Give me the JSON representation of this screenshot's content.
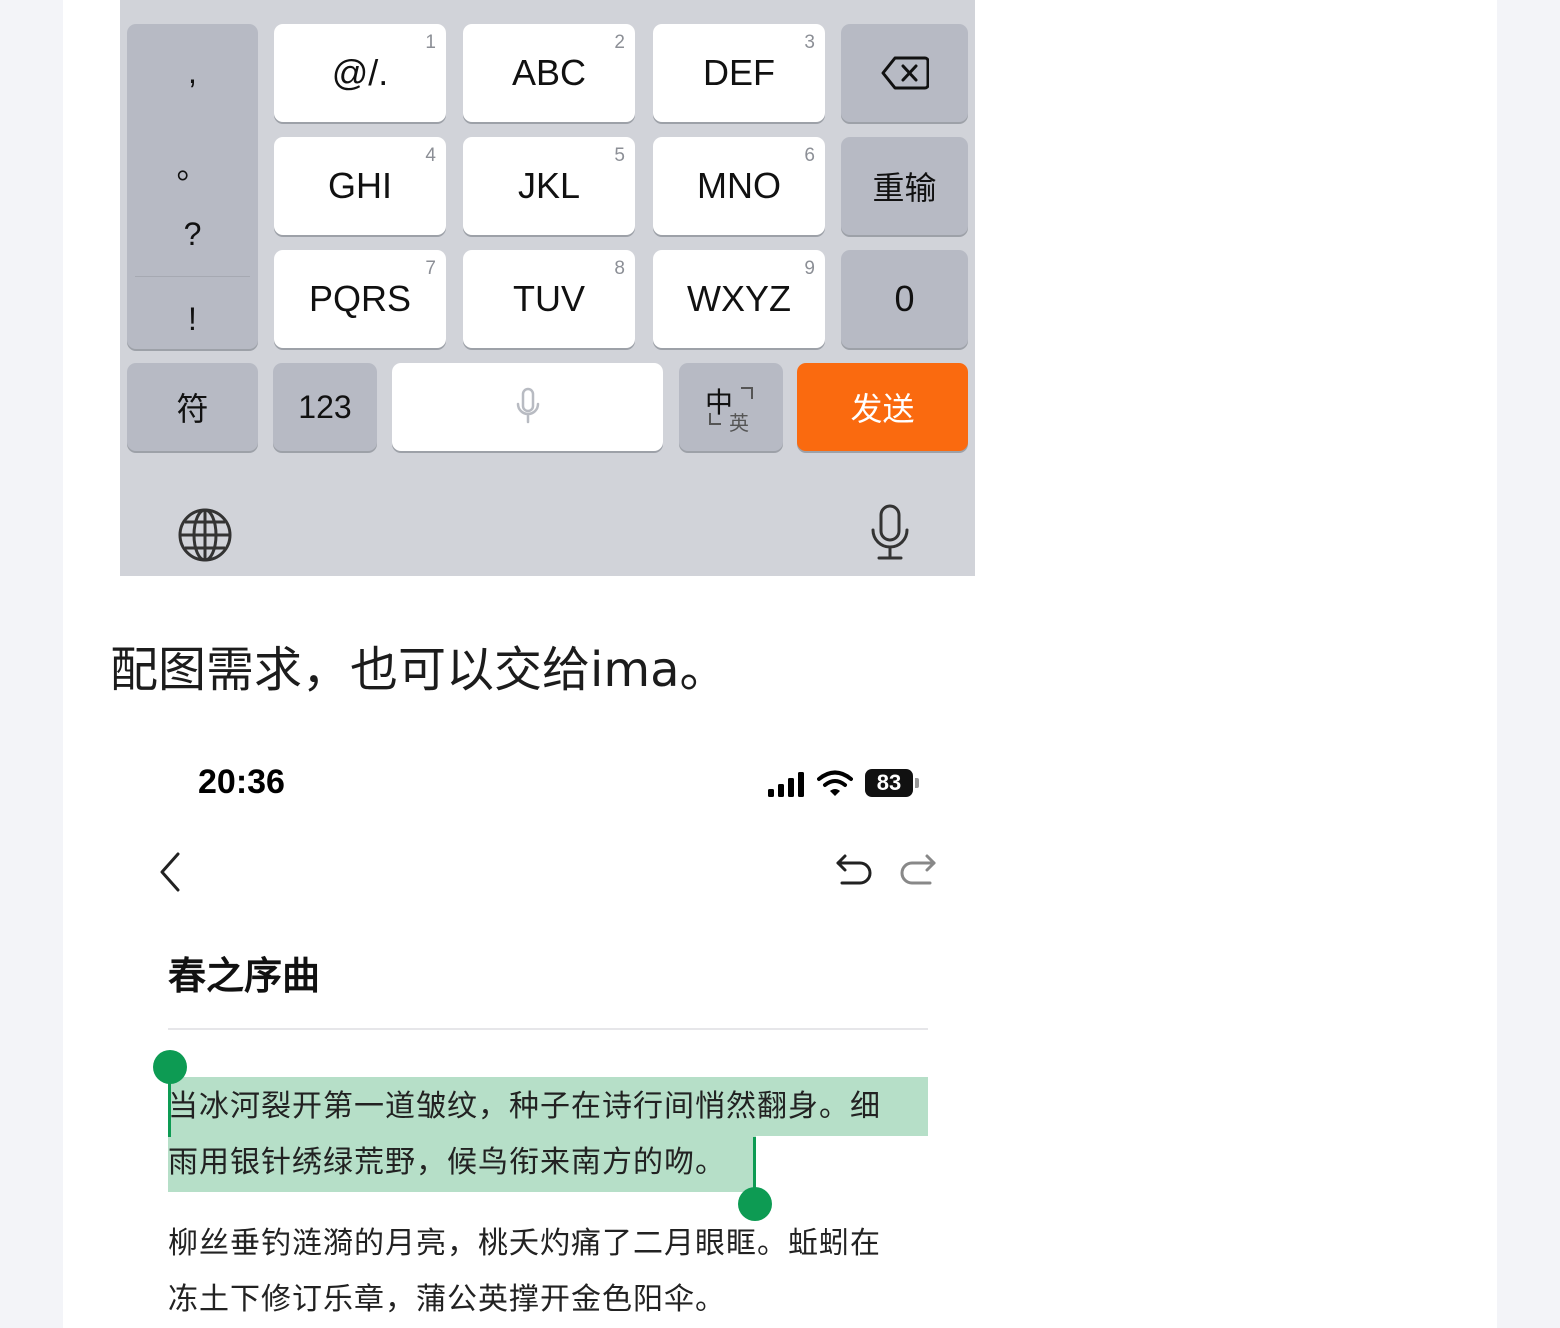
{
  "keyboard": {
    "punctuation": [
      ",",
      "。",
      "?",
      "!"
    ],
    "keys": [
      {
        "label": "@/.",
        "num": "1"
      },
      {
        "label": "ABC",
        "num": "2"
      },
      {
        "label": "DEF",
        "num": "3"
      },
      {
        "label": "GHI",
        "num": "4"
      },
      {
        "label": "JKL",
        "num": "5"
      },
      {
        "label": "MNO",
        "num": "6"
      },
      {
        "label": "PQRS",
        "num": "7"
      },
      {
        "label": "TUV",
        "num": "8"
      },
      {
        "label": "WXYZ",
        "num": "9"
      }
    ],
    "reenter_label": "重输",
    "zero_label": "0",
    "symbols_label": "符",
    "numbers_label": "123",
    "lang_switch_main": "中",
    "lang_switch_sub": "英",
    "send_label": "发送",
    "accent_color": "#fa6a0f"
  },
  "caption": "配图需求，也可以交给ima。",
  "phone": {
    "status": {
      "time": "20:36",
      "battery": "83"
    },
    "document": {
      "title": "春之序曲",
      "selected_lines": [
        "当冰河裂开第一道皱纹，种子在诗行间悄然翻身。细",
        "雨用银针绣绿荒野，候鸟衔来南方的吻。"
      ],
      "lines": [
        "柳丝垂钓涟漪的月亮，桃夭灼痛了二月眼眶。蚯蚓在",
        "冻土下修订乐章，蒲公英撑开金色阳伞。"
      ],
      "selection_color": "#b6dfc8",
      "handle_color": "#0d9b53"
    }
  }
}
